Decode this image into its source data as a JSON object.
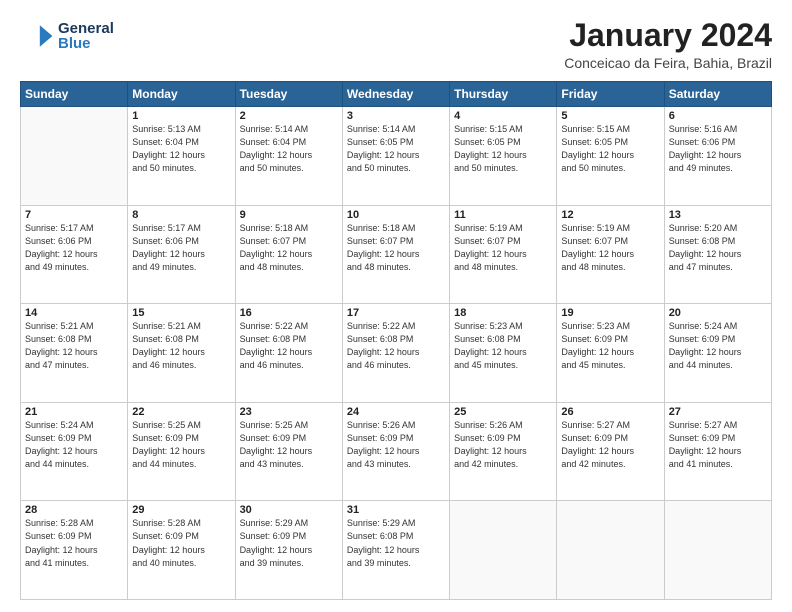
{
  "header": {
    "logo_general": "General",
    "logo_blue": "Blue",
    "month_title": "January 2024",
    "location": "Conceicao da Feira, Bahia, Brazil"
  },
  "calendar": {
    "days_of_week": [
      "Sunday",
      "Monday",
      "Tuesday",
      "Wednesday",
      "Thursday",
      "Friday",
      "Saturday"
    ],
    "weeks": [
      [
        {
          "day": "",
          "info": ""
        },
        {
          "day": "1",
          "info": "Sunrise: 5:13 AM\nSunset: 6:04 PM\nDaylight: 12 hours\nand 50 minutes."
        },
        {
          "day": "2",
          "info": "Sunrise: 5:14 AM\nSunset: 6:04 PM\nDaylight: 12 hours\nand 50 minutes."
        },
        {
          "day": "3",
          "info": "Sunrise: 5:14 AM\nSunset: 6:05 PM\nDaylight: 12 hours\nand 50 minutes."
        },
        {
          "day": "4",
          "info": "Sunrise: 5:15 AM\nSunset: 6:05 PM\nDaylight: 12 hours\nand 50 minutes."
        },
        {
          "day": "5",
          "info": "Sunrise: 5:15 AM\nSunset: 6:05 PM\nDaylight: 12 hours\nand 50 minutes."
        },
        {
          "day": "6",
          "info": "Sunrise: 5:16 AM\nSunset: 6:06 PM\nDaylight: 12 hours\nand 49 minutes."
        }
      ],
      [
        {
          "day": "7",
          "info": "Sunrise: 5:17 AM\nSunset: 6:06 PM\nDaylight: 12 hours\nand 49 minutes."
        },
        {
          "day": "8",
          "info": "Sunrise: 5:17 AM\nSunset: 6:06 PM\nDaylight: 12 hours\nand 49 minutes."
        },
        {
          "day": "9",
          "info": "Sunrise: 5:18 AM\nSunset: 6:07 PM\nDaylight: 12 hours\nand 48 minutes."
        },
        {
          "day": "10",
          "info": "Sunrise: 5:18 AM\nSunset: 6:07 PM\nDaylight: 12 hours\nand 48 minutes."
        },
        {
          "day": "11",
          "info": "Sunrise: 5:19 AM\nSunset: 6:07 PM\nDaylight: 12 hours\nand 48 minutes."
        },
        {
          "day": "12",
          "info": "Sunrise: 5:19 AM\nSunset: 6:07 PM\nDaylight: 12 hours\nand 48 minutes."
        },
        {
          "day": "13",
          "info": "Sunrise: 5:20 AM\nSunset: 6:08 PM\nDaylight: 12 hours\nand 47 minutes."
        }
      ],
      [
        {
          "day": "14",
          "info": "Sunrise: 5:21 AM\nSunset: 6:08 PM\nDaylight: 12 hours\nand 47 minutes."
        },
        {
          "day": "15",
          "info": "Sunrise: 5:21 AM\nSunset: 6:08 PM\nDaylight: 12 hours\nand 46 minutes."
        },
        {
          "day": "16",
          "info": "Sunrise: 5:22 AM\nSunset: 6:08 PM\nDaylight: 12 hours\nand 46 minutes."
        },
        {
          "day": "17",
          "info": "Sunrise: 5:22 AM\nSunset: 6:08 PM\nDaylight: 12 hours\nand 46 minutes."
        },
        {
          "day": "18",
          "info": "Sunrise: 5:23 AM\nSunset: 6:08 PM\nDaylight: 12 hours\nand 45 minutes."
        },
        {
          "day": "19",
          "info": "Sunrise: 5:23 AM\nSunset: 6:09 PM\nDaylight: 12 hours\nand 45 minutes."
        },
        {
          "day": "20",
          "info": "Sunrise: 5:24 AM\nSunset: 6:09 PM\nDaylight: 12 hours\nand 44 minutes."
        }
      ],
      [
        {
          "day": "21",
          "info": "Sunrise: 5:24 AM\nSunset: 6:09 PM\nDaylight: 12 hours\nand 44 minutes."
        },
        {
          "day": "22",
          "info": "Sunrise: 5:25 AM\nSunset: 6:09 PM\nDaylight: 12 hours\nand 44 minutes."
        },
        {
          "day": "23",
          "info": "Sunrise: 5:25 AM\nSunset: 6:09 PM\nDaylight: 12 hours\nand 43 minutes."
        },
        {
          "day": "24",
          "info": "Sunrise: 5:26 AM\nSunset: 6:09 PM\nDaylight: 12 hours\nand 43 minutes."
        },
        {
          "day": "25",
          "info": "Sunrise: 5:26 AM\nSunset: 6:09 PM\nDaylight: 12 hours\nand 42 minutes."
        },
        {
          "day": "26",
          "info": "Sunrise: 5:27 AM\nSunset: 6:09 PM\nDaylight: 12 hours\nand 42 minutes."
        },
        {
          "day": "27",
          "info": "Sunrise: 5:27 AM\nSunset: 6:09 PM\nDaylight: 12 hours\nand 41 minutes."
        }
      ],
      [
        {
          "day": "28",
          "info": "Sunrise: 5:28 AM\nSunset: 6:09 PM\nDaylight: 12 hours\nand 41 minutes."
        },
        {
          "day": "29",
          "info": "Sunrise: 5:28 AM\nSunset: 6:09 PM\nDaylight: 12 hours\nand 40 minutes."
        },
        {
          "day": "30",
          "info": "Sunrise: 5:29 AM\nSunset: 6:09 PM\nDaylight: 12 hours\nand 39 minutes."
        },
        {
          "day": "31",
          "info": "Sunrise: 5:29 AM\nSunset: 6:08 PM\nDaylight: 12 hours\nand 39 minutes."
        },
        {
          "day": "",
          "info": ""
        },
        {
          "day": "",
          "info": ""
        },
        {
          "day": "",
          "info": ""
        }
      ]
    ]
  }
}
